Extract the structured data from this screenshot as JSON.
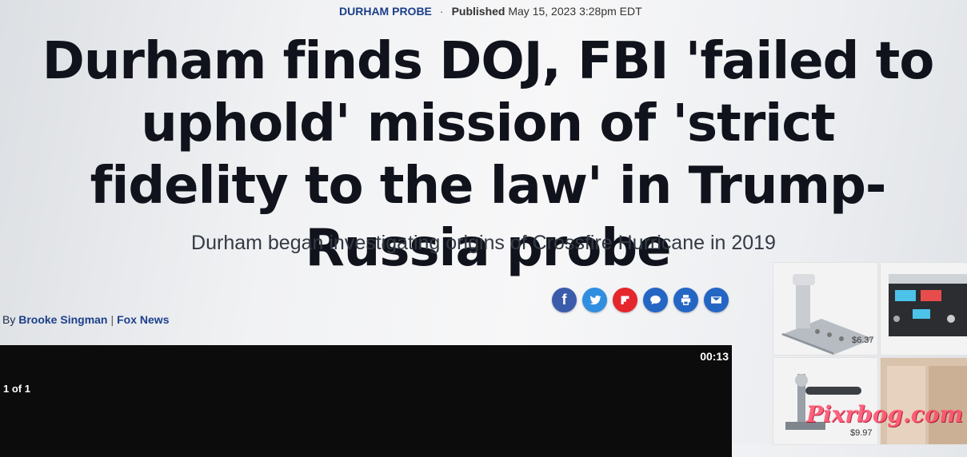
{
  "article": {
    "category": "DURHAM PROBE",
    "published_label": "Published",
    "published_date": "May 15, 2023 3:28pm EDT",
    "headline": "Durham finds DOJ, FBI 'failed to uphold' mission of 'strict fidelity to the law' in Trump-Russia probe",
    "subheadline": "Durham began investigating origins of Crossfire Hurricane in 2019"
  },
  "byline": {
    "prefix": "By",
    "author": "Brooke Singman",
    "separator": "|",
    "outlet": "Fox News"
  },
  "share": {
    "buttons": [
      {
        "name": "facebook",
        "icon": "facebook-icon",
        "glyph": "f",
        "color": "#3b5bab"
      },
      {
        "name": "twitter",
        "icon": "twitter-icon",
        "glyph": "",
        "color": "#2f8ee0"
      },
      {
        "name": "flipboard",
        "icon": "flipboard-icon",
        "glyph": "",
        "color": "#e5262c"
      },
      {
        "name": "comments",
        "icon": "comment-icon",
        "glyph": "",
        "color": "#2466c4"
      },
      {
        "name": "print",
        "icon": "print-icon",
        "glyph": "",
        "color": "#2466c4"
      },
      {
        "name": "email",
        "icon": "email-icon",
        "glyph": "",
        "color": "#2466c4"
      }
    ]
  },
  "video": {
    "time": "00:13",
    "counter": "1 of 1"
  },
  "ads": {
    "items": [
      {
        "price": "$6.37"
      },
      {
        "price": "$9.97"
      }
    ]
  },
  "watermark": "Pixrbog.com",
  "colors": {
    "link_blue": "#1c3f8a",
    "headline": "#10131b"
  }
}
